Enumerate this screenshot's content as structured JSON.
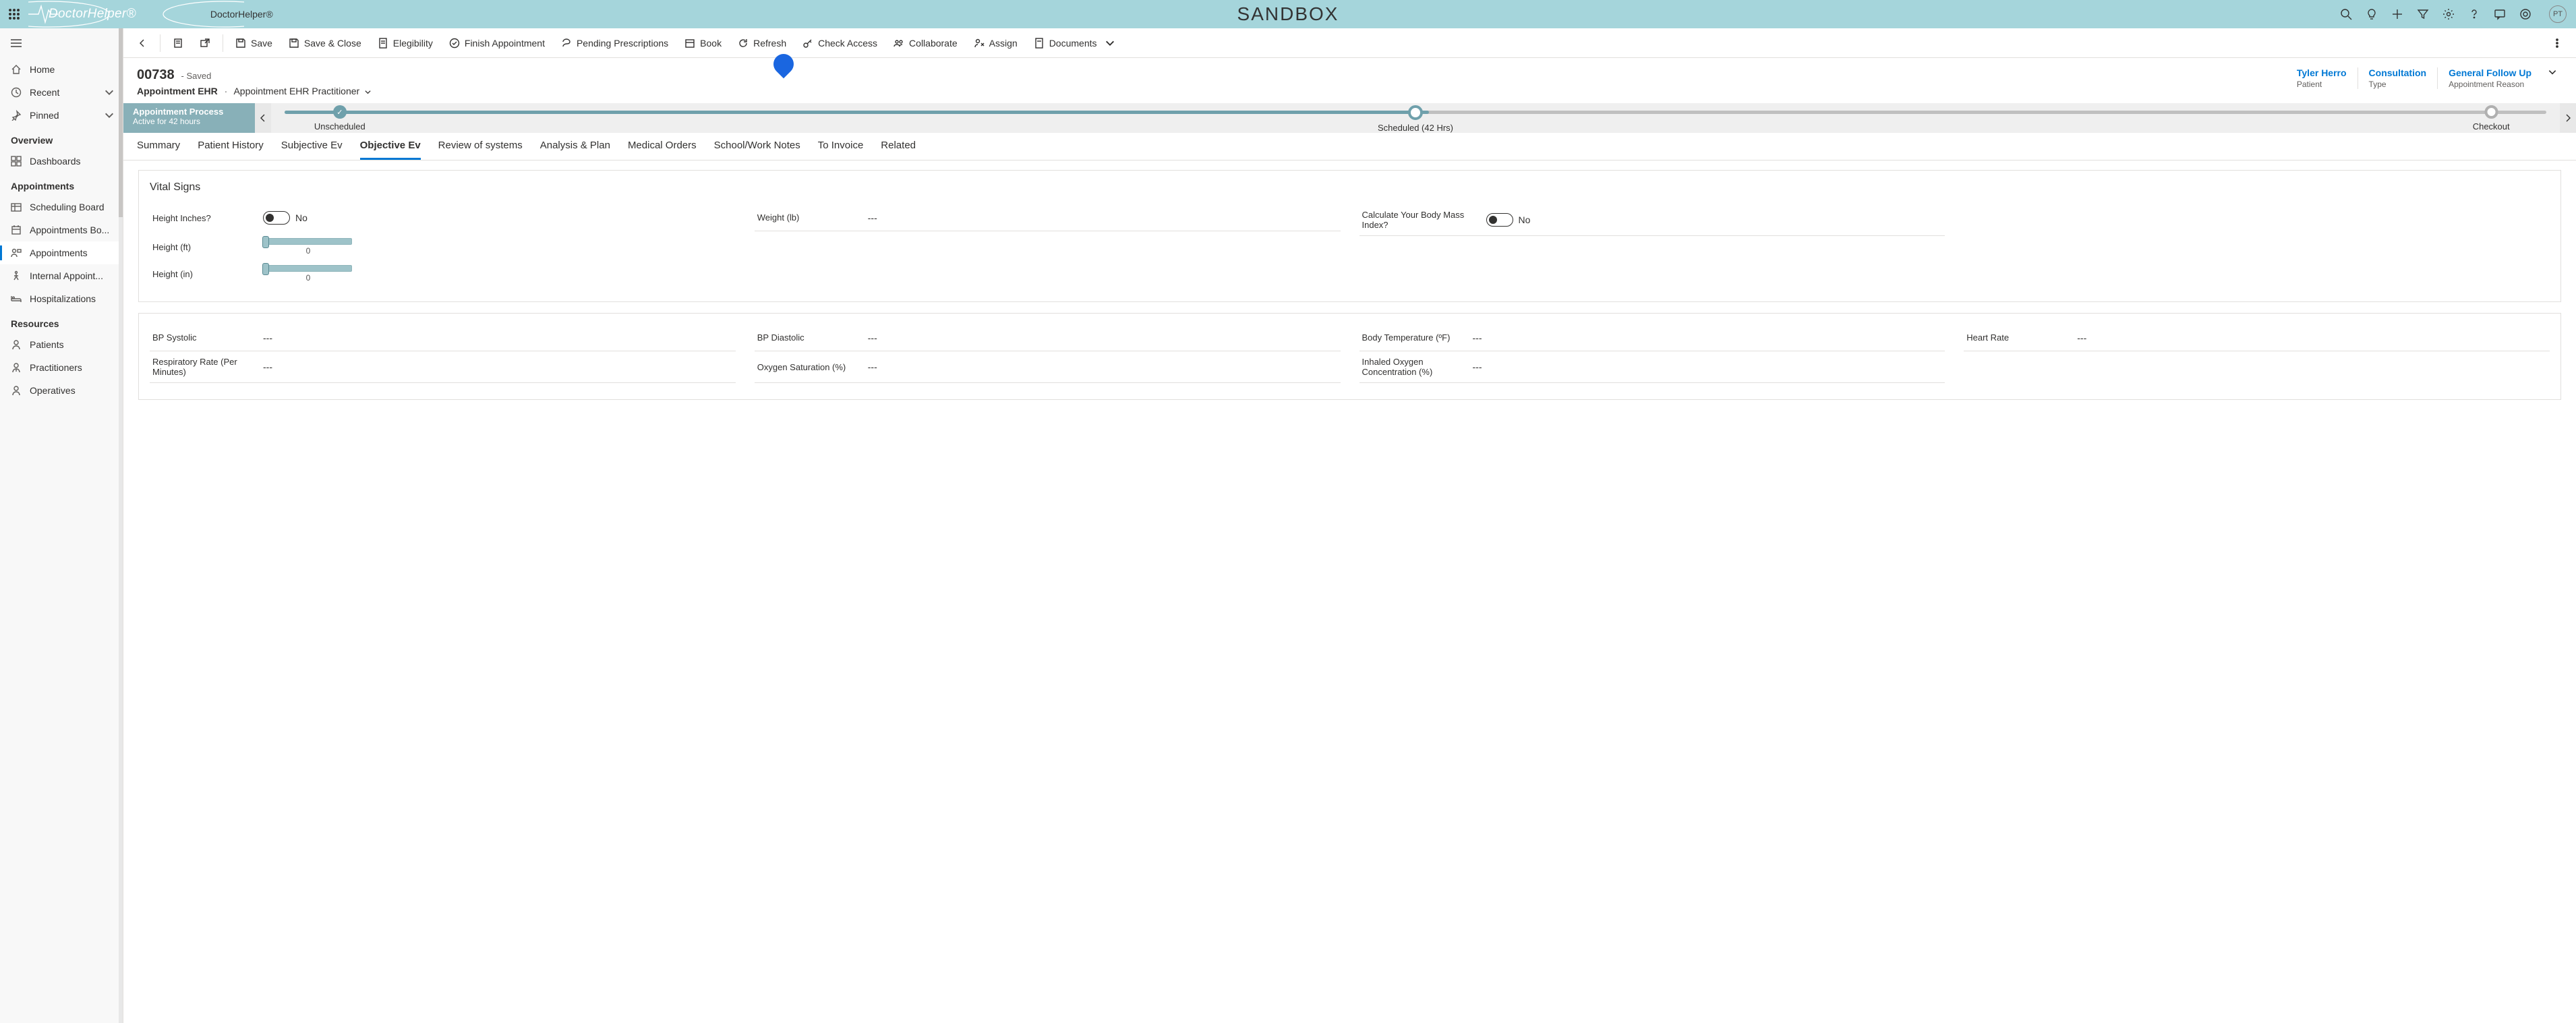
{
  "banner": {
    "logo_text": "DoctorHelper®",
    "brand2": "DoctorHelper®",
    "center_label": "SANDBOX",
    "avatar": "PT"
  },
  "sidebar": {
    "home": "Home",
    "recent": "Recent",
    "pinned": "Pinned",
    "overview_head": "Overview",
    "dashboards": "Dashboards",
    "appointments_head": "Appointments",
    "scheduling_board": "Scheduling Board",
    "appointments_board": "Appointments Bo...",
    "appointments": "Appointments",
    "internal_appoint": "Internal Appoint...",
    "hospitalizations": "Hospitalizations",
    "resources_head": "Resources",
    "patients": "Patients",
    "practitioners": "Practitioners",
    "operatives": "Operatives"
  },
  "cmd": {
    "save": "Save",
    "save_close": "Save & Close",
    "elegibility": "Elegibility",
    "finish": "Finish Appointment",
    "pending": "Pending Prescriptions",
    "book": "Book",
    "refresh": "Refresh",
    "check_access": "Check Access",
    "collaborate": "Collaborate",
    "assign": "Assign",
    "documents": "Documents"
  },
  "record": {
    "id": "00738",
    "saved": "- Saved",
    "entity": "Appointment EHR",
    "view": "Appointment EHR Practitioner",
    "patient_v": "Tyler Herro",
    "patient_k": "Patient",
    "type_v": "Consultation",
    "type_k": "Type",
    "reason_v": "General Follow Up",
    "reason_k": "Appointment Reason"
  },
  "stage": {
    "title": "Appointment Process",
    "sub": "Active for 42 hours",
    "s1": "Unscheduled",
    "s2": "Scheduled  (42 Hrs)",
    "s3": "Checkout"
  },
  "tabs": {
    "summary": "Summary",
    "history": "Patient History",
    "subjective": "Subjective Ev",
    "objective": "Objective Ev",
    "review": "Review of systems",
    "analysis": "Analysis & Plan",
    "orders": "Medical Orders",
    "notes": "School/Work Notes",
    "invoice": "To Invoice",
    "related": "Related"
  },
  "vitals": {
    "title": "Vital Signs",
    "height_inches_q": "Height Inches?",
    "no": "No",
    "weight_lbl": "Weight (lb)",
    "weight_val": "---",
    "bmi_q": "Calculate Your Body Mass Index?",
    "height_ft": "Height (ft)",
    "height_ft_val": "0",
    "height_in": "Height (in)",
    "height_in_val": "0",
    "bp_sys": "BP Systolic",
    "bp_dia": "BP Diastolic",
    "body_temp": "Body Temperature (ºF)",
    "heart_rate": "Heart Rate",
    "resp_rate": "Respiratory Rate (Per Minutes)",
    "oxy_sat": "Oxygen Saturation (%)",
    "inh_oxy": "Inhaled Oxygen Concentration (%)",
    "dash": "---"
  }
}
